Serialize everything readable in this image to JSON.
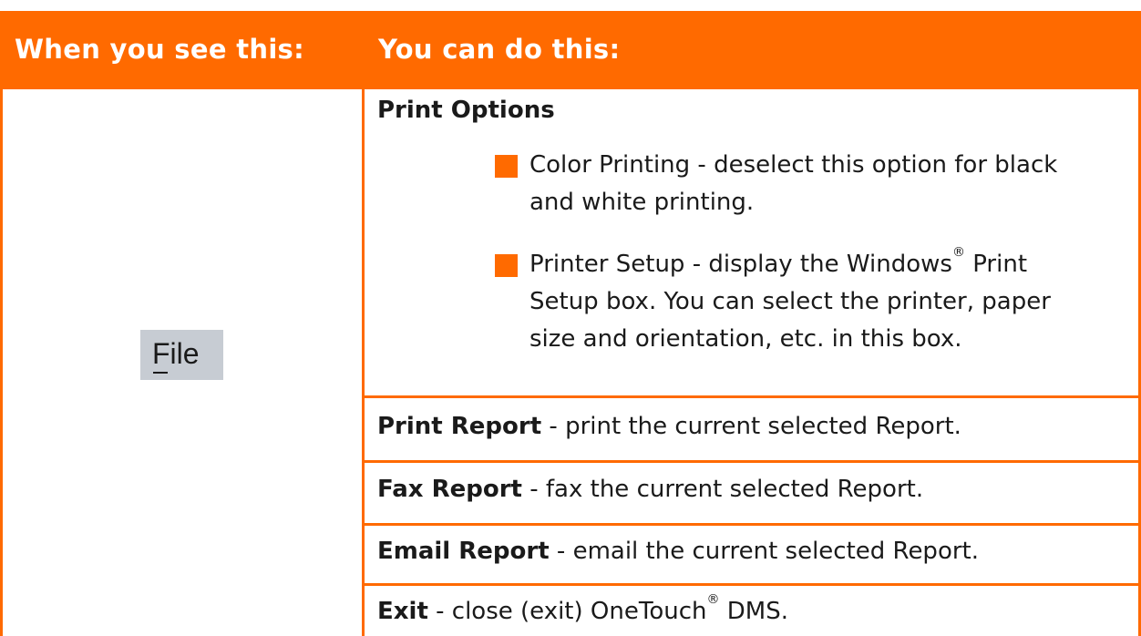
{
  "header": {
    "col1": "When you see this:",
    "col2": "You can do this:"
  },
  "left_cell": {
    "menu_label": "File",
    "mnemonic": "F"
  },
  "print_options": {
    "title": "Print Options",
    "items": [
      {
        "lines": [
          "Color Printing - deselect this option for black",
          "and white printing."
        ]
      },
      {
        "line1_pre": "Printer Setup - display the Windows",
        "reg": "®",
        "line1_post": " Print",
        "lines_rest": [
          "Setup box. You can select the printer, paper",
          "size and orientation, etc. in this box."
        ]
      }
    ]
  },
  "rows": [
    {
      "label": "Print Report",
      "desc": " - print the current selected Report."
    },
    {
      "label": "Fax Report",
      "desc": " - fax the current selected Report."
    },
    {
      "label": "Email Report",
      "desc": " - email the current selected Report."
    },
    {
      "label": "Exit",
      "desc_pre": " - close (exit) OneTouch",
      "reg": "®",
      "desc_post": " DMS."
    }
  ],
  "colors": {
    "accent": "#ff6a00",
    "chip": "#c7ccd3"
  }
}
